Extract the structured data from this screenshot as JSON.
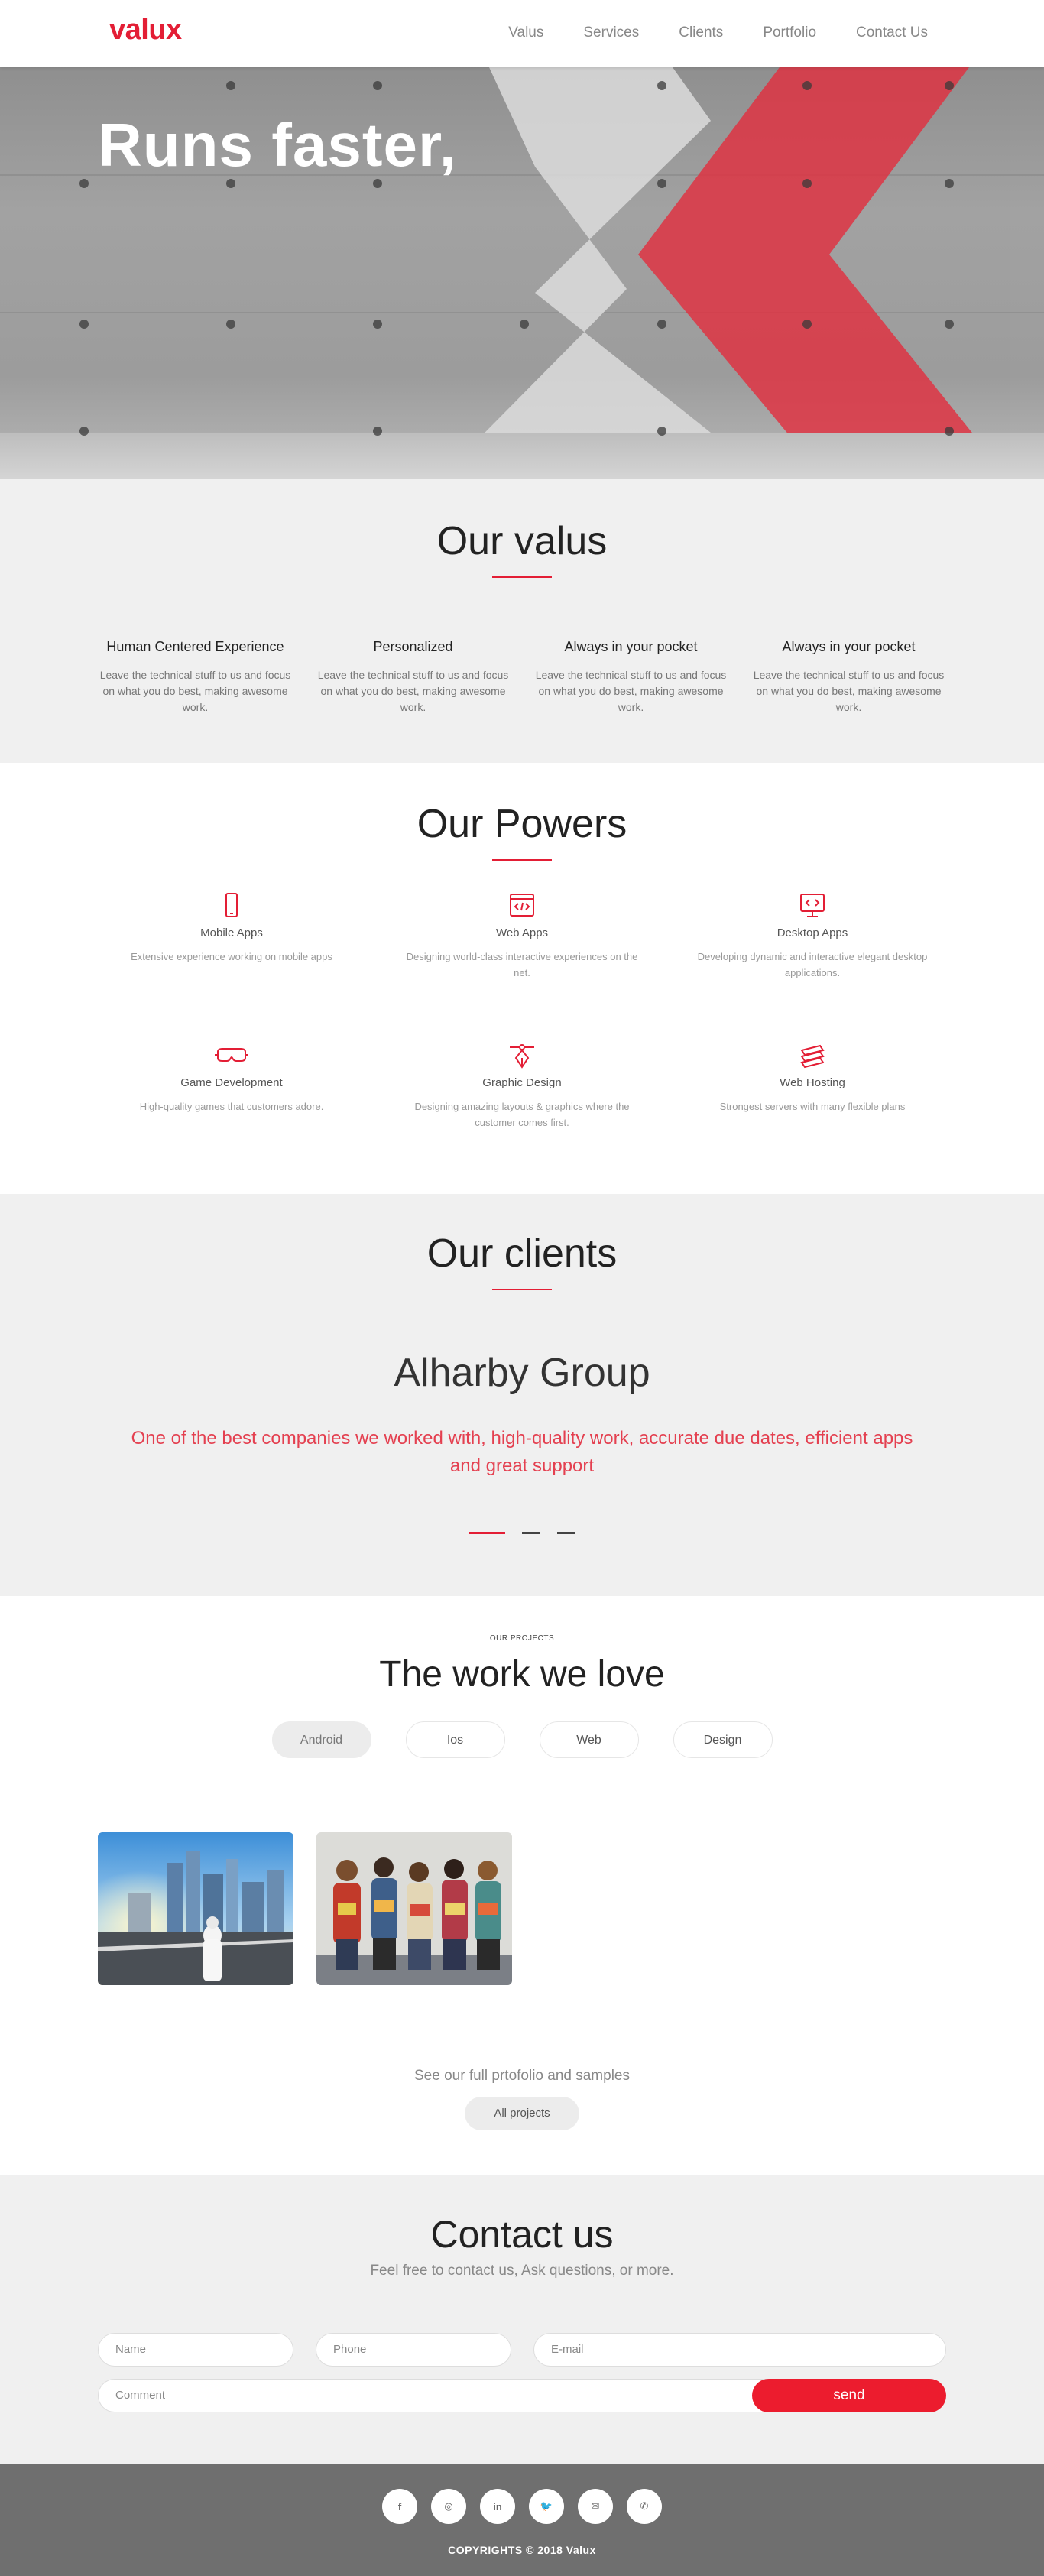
{
  "nav": {
    "logo": "valux",
    "items": [
      "Valus",
      "Services",
      "Clients",
      "Portfolio",
      "Contact Us"
    ]
  },
  "hero": {
    "headline": "Runs faster,"
  },
  "valus": {
    "title": "Our valus",
    "items": [
      {
        "title": "Human Centered Experience",
        "text": "Leave the technical stuff to us and focus on what you do best, making awesome work."
      },
      {
        "title": "Personalized",
        "text": "Leave the technical stuff to us and focus on what you do best, making awesome work."
      },
      {
        "title": "Always in your pocket",
        "text": "Leave the technical stuff to us and focus on what you do best, making awesome work."
      },
      {
        "title": "Always in your pocket",
        "text": "Leave the technical stuff to us and focus on what you do best, making awesome work."
      }
    ]
  },
  "powers": {
    "title": "Our Powers",
    "items": [
      {
        "icon": "mobile-icon",
        "title": "Mobile Apps",
        "text": "Extensive experience working on mobile apps"
      },
      {
        "icon": "web-code-icon",
        "title": "Web Apps",
        "text": "Designing world-class interactive experiences on the net."
      },
      {
        "icon": "desktop-icon",
        "title": "Desktop Apps",
        "text": "Developing dynamic and interactive elegant desktop applications."
      },
      {
        "icon": "vr-headset-icon",
        "title": "Game Development",
        "text": "High-quality games that customers adore."
      },
      {
        "icon": "pen-tool-icon",
        "title": "Graphic Design",
        "text": "Designing amazing layouts & graphics where the customer comes first."
      },
      {
        "icon": "server-layers-icon",
        "title": "Web Hosting",
        "text": "Strongest servers with many flexible plans"
      }
    ]
  },
  "clients": {
    "title": "Our clients",
    "name": "Alharby Group",
    "quote": "One of the best companies we worked with, high-quality work, accurate due dates, efficient apps and great support"
  },
  "projects": {
    "kicker": "OUR PROJECTS",
    "title": "The work we love",
    "filters": [
      "Android",
      "Ios",
      "Web",
      "Design"
    ],
    "see_text": "See our full prtofolio and samples",
    "all_button": "All projects"
  },
  "contact": {
    "title": "Contact us",
    "subtitle": "Feel free to contact us, Ask questions, or more.",
    "name_placeholder": "Name",
    "phone_placeholder": "Phone",
    "email_placeholder": "E-mail",
    "comment_placeholder": "Comment",
    "send_label": "send"
  },
  "footer": {
    "socials": [
      {
        "icon": "facebook-icon",
        "glyph": "f"
      },
      {
        "icon": "instagram-icon",
        "glyph": "◎"
      },
      {
        "icon": "linkedin-icon",
        "glyph": "in"
      },
      {
        "icon": "twitter-icon",
        "glyph": "🐦"
      },
      {
        "icon": "email-icon",
        "glyph": "✉"
      },
      {
        "icon": "phone-icon",
        "glyph": "✆"
      }
    ],
    "copyright": "COPYRIGHTS © 2018 Valux"
  },
  "colors": {
    "accent": "#e31e35",
    "send": "#ec1c2e"
  }
}
